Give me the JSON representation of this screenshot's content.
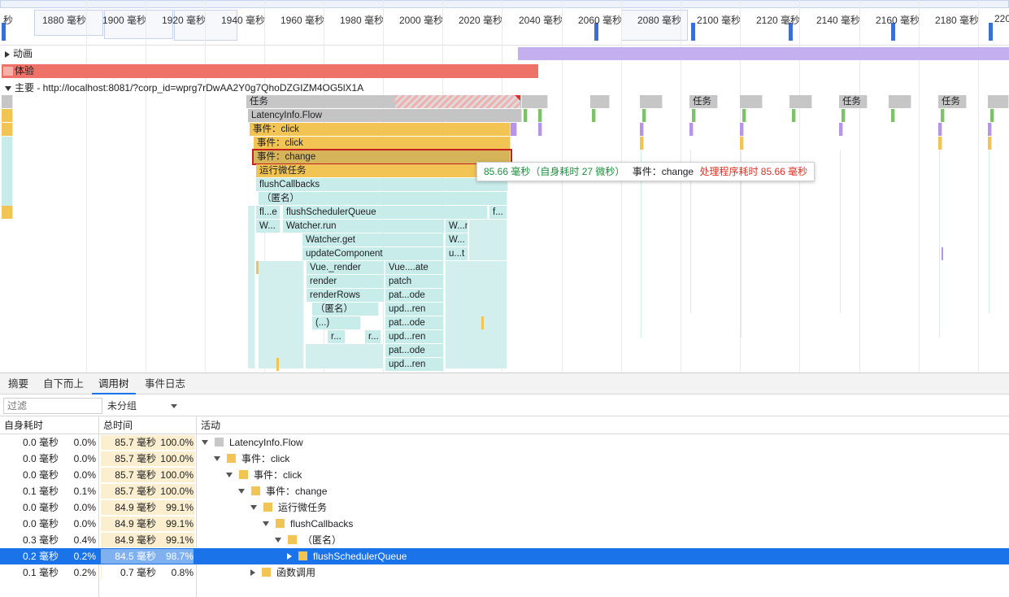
{
  "timeline": {
    "ticks": [
      "1880 毫秒",
      "1900 毫秒",
      "1920 毫秒",
      "1940 毫秒",
      "1960 毫秒",
      "1980 毫秒",
      "2000 毫秒",
      "2020 毫秒",
      "2040 毫秒",
      "2060 毫秒",
      "2080 毫秒",
      "2100 毫秒",
      "2120 毫秒",
      "2140 毫秒",
      "2160 毫秒",
      "2180 毫秒",
      "220"
    ],
    "tick_partial_left": "秒"
  },
  "tracks": {
    "animation": "动画",
    "experience": "体验",
    "main": "主要 - http://localhost:8081/?corp_id=wprg7rDwAA2Y0g7QhoDZGIZM4OG5lX1A"
  },
  "flame": {
    "task": "任务",
    "latency": "LatencyInfo.Flow",
    "event_click1": "事件：click",
    "event_click2": "事件：click",
    "event_change": "事件：change",
    "microtask": "运行微任务",
    "flush": "flushCallbacks",
    "anon": "（匿名）",
    "fl_e": "fl...e",
    "flush_queue": "flushSchedulerQueue",
    "f_dots": "f...",
    "w_dots": "W...",
    "watcher_run": "Watcher.run",
    "w_n": "W...n",
    "watcher_get": "Watcher.get",
    "w_dots2": "W...",
    "update_component": "updateComponent",
    "u_t": "u...t",
    "vue_render": "Vue._render",
    "vue_ate": "Vue....ate",
    "render": "render",
    "patch": "patch",
    "render_rows": "renderRows",
    "pat_ode1": "pat...ode",
    "anon2": "（匿名）",
    "upd_ren1": "upd...ren",
    "paren_dots": "(...)",
    "pat_ode2": "pat...ode",
    "r_dots1": "r...",
    "r_dots2": "r...",
    "upd_ren2": "upd...ren",
    "pat_ode3": "pat...ode",
    "upd_ren3": "upd...ren",
    "task_right1": "任务",
    "task_right2": "任务",
    "task_right3": "任务"
  },
  "tooltip": {
    "duration": "85.66 毫秒（自身耗时 27 微秒）",
    "event": "事件：change",
    "warning": "处理程序耗时 85.66 毫秒"
  },
  "tabs": [
    "摘要",
    "自下而上",
    "调用树",
    "事件日志"
  ],
  "active_tab": "调用树",
  "toolbar": {
    "filter_placeholder": "过滤",
    "group": "未分组"
  },
  "columns": {
    "self": "自身耗时",
    "total": "总时间",
    "activity": "活动"
  },
  "rows": [
    {
      "self": "0.0 毫秒",
      "self_pct": "0.0%",
      "total": "85.7 毫秒",
      "total_pct": "100.0%",
      "name": "LatencyInfo.Flow",
      "depth": 0,
      "expand": "down",
      "color": "gray",
      "ratio": 1.0
    },
    {
      "self": "0.0 毫秒",
      "self_pct": "0.0%",
      "total": "85.7 毫秒",
      "total_pct": "100.0%",
      "name": "事件：click",
      "depth": 1,
      "expand": "down",
      "color": "yellow",
      "ratio": 1.0
    },
    {
      "self": "0.0 毫秒",
      "self_pct": "0.0%",
      "total": "85.7 毫秒",
      "total_pct": "100.0%",
      "name": "事件：click",
      "depth": 2,
      "expand": "down",
      "color": "yellow",
      "ratio": 1.0
    },
    {
      "self": "0.1 毫秒",
      "self_pct": "0.1%",
      "total": "85.7 毫秒",
      "total_pct": "100.0%",
      "name": "事件：change",
      "depth": 3,
      "expand": "down",
      "color": "yellow",
      "ratio": 1.0
    },
    {
      "self": "0.0 毫秒",
      "self_pct": "0.0%",
      "total": "84.9 毫秒",
      "total_pct": "99.1%",
      "name": "运行微任务",
      "depth": 4,
      "expand": "down",
      "color": "yellow",
      "ratio": 0.991
    },
    {
      "self": "0.0 毫秒",
      "self_pct": "0.0%",
      "total": "84.9 毫秒",
      "total_pct": "99.1%",
      "name": "flushCallbacks",
      "depth": 5,
      "expand": "down",
      "color": "yellow",
      "ratio": 0.991
    },
    {
      "self": "0.3 毫秒",
      "self_pct": "0.4%",
      "total": "84.9 毫秒",
      "total_pct": "99.1%",
      "name": "（匿名）",
      "depth": 6,
      "expand": "down",
      "color": "yellow",
      "ratio": 0.991
    },
    {
      "self": "0.2 毫秒",
      "self_pct": "0.2%",
      "total": "84.5 毫秒",
      "total_pct": "98.7%",
      "name": "flushSchedulerQueue",
      "depth": 7,
      "expand": "right",
      "color": "yellow",
      "ratio": 0.987,
      "selected": true
    },
    {
      "self": "0.1 毫秒",
      "self_pct": "0.2%",
      "total": "0.7 毫秒",
      "total_pct": "0.8%",
      "name": "函数调用",
      "depth": 4,
      "expand": "right",
      "color": "yellow",
      "ratio": 0.008
    }
  ]
}
